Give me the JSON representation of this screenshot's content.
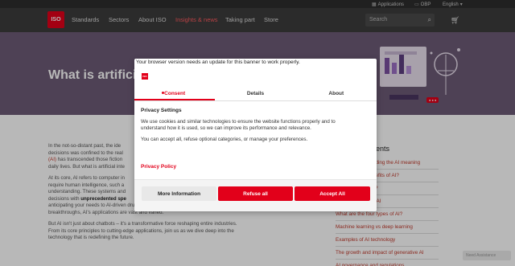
{
  "utilbar": {
    "applications": "Applications",
    "obp": "OBP",
    "language": "English"
  },
  "nav": {
    "logo": "ISO",
    "items": [
      "Standards",
      "Sectors",
      "About ISO",
      "Insights & news",
      "Taking part",
      "Store"
    ],
    "active": "Insights & news",
    "search_placeholder": "Search"
  },
  "hero": {
    "title": "What is artificia"
  },
  "article": {
    "p1_a": "In the not-so-distant past, the ide",
    "p1_b": "decisions was confined to the real",
    "p1_c_link": "(AI)",
    "p1_c": " has transcended those fiction",
    "p1_d": "daily lives. But what is artificial inte",
    "p2_a": "At its core, AI refers to computer in",
    "p2_b": "require human intelligence, such a",
    "p2_c": "understanding. These systems and",
    "p2_d_pre": "decisions with ",
    "p2_d_bold": "unprecedented spe",
    "p2_e": "anticipating your needs to AI-driven drug development accelerating medical",
    "p2_f": "breakthroughs, AI's applications are vast and varied.",
    "p3_a": "But AI isn't just about chatbots – it's a transformative force reshaping entire industries.",
    "p3_b": "From its core principles to cutting-edge applications, join us as we dive deep into the",
    "p3_c": "technology that is redefining the future."
  },
  "toc": {
    "title": "ents",
    "items": [
      "nding the AI meaning",
      "nefits of AI?",
      "s?",
      "s AI",
      "What are the four types of AI?",
      "Machine learning vs deep learning",
      "Examples of AI technology",
      "The growth and impact of generative AI",
      "AI governance and regulations"
    ]
  },
  "corner_button": "Need Assistance",
  "modal": {
    "banner": "Your browser version needs an update for this banner to work properly.",
    "logo": "ISO",
    "tabs": [
      "Consent",
      "Details",
      "About"
    ],
    "active_tab": "Consent",
    "section_title": "Privacy Settings",
    "text1": "We use cookies and similar technologies to ensure the website functions properly and to understand how it is used, so we can improve its performance and relevance.",
    "text2": "You can accept all, refuse optional categories, or manage your preferences.",
    "policy_link": "Privacy Policy",
    "buttons": {
      "more": "More Information",
      "refuse": "Refuse all",
      "accept": "Accept All"
    }
  },
  "colors": {
    "brand_red": "#e2001a",
    "nav_bg": "#3c3c3c",
    "hero_bg": "#6d5a76"
  }
}
